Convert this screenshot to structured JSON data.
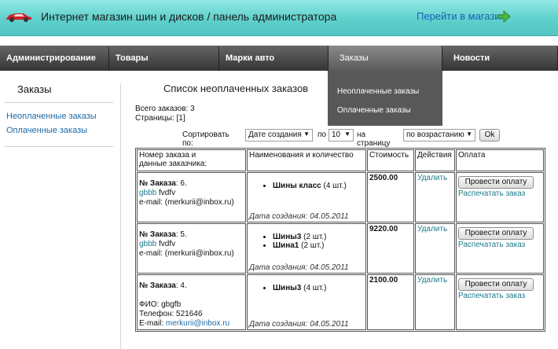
{
  "header": {
    "title": "Интернет магазин шин и дисков / панель администратора",
    "to_store": "Перейти в магазин",
    "logo_icon": "car-logo-icon",
    "arrow_icon": "green-arrow-right-icon",
    "bar_color": "#5ed0cc"
  },
  "nav": {
    "items": [
      {
        "label": "Администрирование"
      },
      {
        "label": "Товары"
      },
      {
        "label": "Марки авто"
      },
      {
        "label": "Заказы"
      },
      {
        "label": "Новости"
      }
    ],
    "dropdown": [
      "Неоплаченные заказы",
      "Оплаченные заказы"
    ]
  },
  "sidebar": {
    "title": "Заказы",
    "links": [
      "Неоплаченные заказы",
      "Оплаченные заказы"
    ]
  },
  "main": {
    "title": "Список неоплаченных заказов",
    "total": "Всего заказов: 3",
    "pages": "Страницы: [1]",
    "sort": {
      "label": "Сортировать по:",
      "field": "Дате создания",
      "by_label": "по",
      "per_page": "10",
      "per_page_label": "на страницу",
      "order": "по возрастанию",
      "ok": "Ok"
    },
    "table": {
      "headers": {
        "order": "Номер заказа и",
        "order2": "данные заказчика:",
        "items": "Наименования и количество",
        "cost": "Стоимость",
        "actions": "Действия",
        "payment": "Оплата"
      },
      "rows": [
        {
          "order_label": "№ Заказа",
          "order_no": ": 6.",
          "line2_link": "gbbb",
          "line2_rest": " fvdfv",
          "email": "e-mail: (merkurii@inbox.ru)",
          "items": [
            {
              "name": "Шины класс",
              "qty": " (4 шт.)"
            }
          ],
          "date": "Дата создания: 04.05.2011",
          "cost": "2500.00",
          "delete": "Удалить",
          "pay": "Провести оплату",
          "print": "Распечатать заказ"
        },
        {
          "order_label": "№ Заказа",
          "order_no": ": 5.",
          "line2_link": "gbbb",
          "line2_rest": " fvdfv",
          "email": "e-mail: (merkurii@inbox.ru)",
          "items": [
            {
              "name": "Шины3",
              "qty": " (2 шт.)"
            },
            {
              "name": "Шина1",
              "qty": " (2 шт.)"
            }
          ],
          "date": "Дата создания: 04.05.2011",
          "cost": "9220.00",
          "delete": "Удалить",
          "pay": "Провести оплату",
          "print": "Распечатать заказ"
        },
        {
          "order_label": "№ Заказа",
          "order_no": ": 4.",
          "fio": "ФИО: gbgfb",
          "phone": "Телефон: 521646",
          "email_label": "E-mail: ",
          "email_link": "merkurii@inbox.ru",
          "items": [
            {
              "name": "Шины3",
              "qty": " (4 шт.)"
            }
          ],
          "date": "Дата создания: 04.05.2011",
          "cost": "2100.00",
          "delete": "Удалить",
          "pay": "Провести оплату",
          "print": "Распечатать заказ"
        }
      ]
    }
  }
}
